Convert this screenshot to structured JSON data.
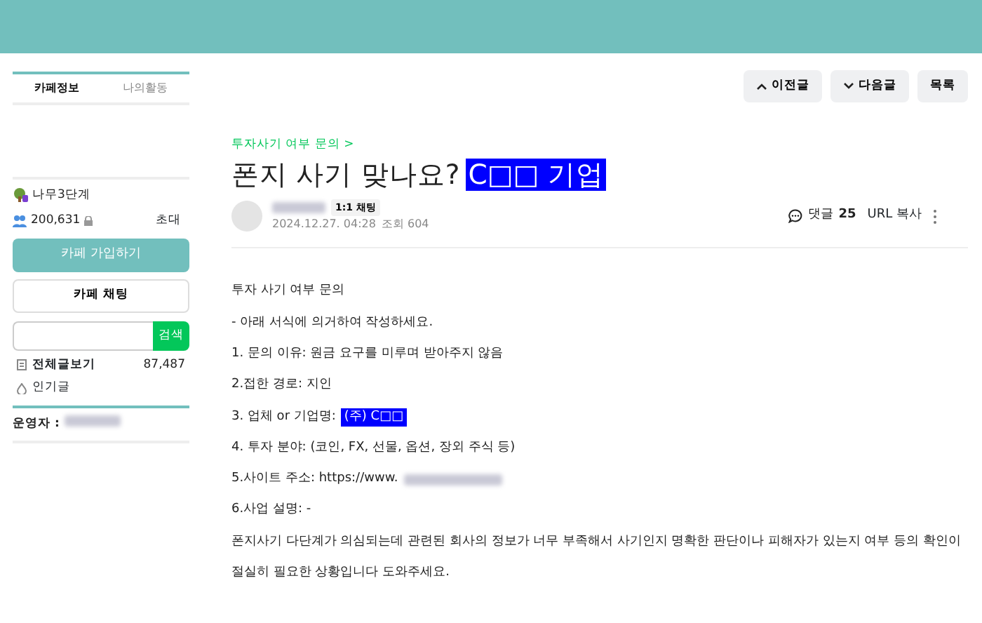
{
  "sidebar": {
    "tabs": [
      {
        "label": "카페정보",
        "selected": true
      },
      {
        "label": "나의활동",
        "selected": false
      }
    ],
    "level": "나무3단계",
    "members": "200,631",
    "invite": "초대",
    "join_button": "카페 가입하기",
    "chat_button": "카페 채팅",
    "search_button": "검색",
    "menu": [
      {
        "kind": "all",
        "label": "전체글보기",
        "count": "87,487"
      },
      {
        "kind": "popular",
        "label": "인기글"
      }
    ],
    "operator_label": "운영자 :"
  },
  "nav_buttons": [
    {
      "kind": "prev",
      "label": "이전글"
    },
    {
      "kind": "next",
      "label": "다음글"
    },
    {
      "kind": "list",
      "label": "목록"
    }
  ],
  "article": {
    "category": "투자사기 여부 문의 >",
    "title": "폰지 사기 맞나요?",
    "title_highlight": "C□□ 기업",
    "chat_badge": "1:1 채팅",
    "date": "2024.12.27. 04:28",
    "views": "조회 604",
    "comments_label": "댓글",
    "comments_count": "25",
    "url_copy": "URL 복사",
    "body": [
      {
        "text": "투자 사기 여부 문의"
      },
      {
        "text": "-  아래 서식에 의거하여 작성하세요."
      },
      {
        "text": "1. 문의 이유: 원금 요구를 미루며 받아주지 않음"
      },
      {
        "text": "2.접한 경로: 지인"
      },
      {
        "text": "3. 업체 or 기업명:",
        "highlight": "(주) C□□"
      },
      {
        "text": "4. 투자 분야: (코인, FX, 선물, 옵션, 장외 주식 등)"
      },
      {
        "text": "5.사이트 주소: https://www.",
        "redacted": true
      },
      {
        "text": "6.사업 설명: -"
      },
      {
        "text": "폰지사기 다단계가 의심되는데 관련된 회사의 정보가 너무 부족해서 사기인지 명확한 판단이나 피해자가 있는지 여부 등의 확인이"
      },
      {
        "text": "절실히 필요한 상황입니다 도와주세요."
      }
    ]
  }
}
